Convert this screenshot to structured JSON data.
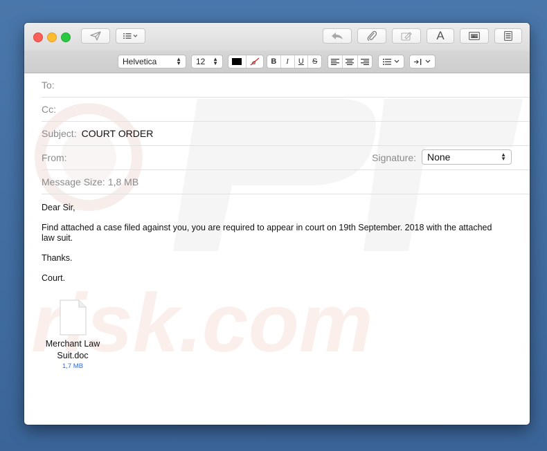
{
  "toolbar": {
    "send_icon": "paper-plane-icon",
    "header_fields_icon": "list-icon",
    "reply_icon": "reply-arrow-icon",
    "attach_icon": "paperclip-icon",
    "markup_icon": "signature-icon",
    "format_label": "A",
    "photo_icon": "photo-browser-icon",
    "stationery_icon": "stationery-icon"
  },
  "format_bar": {
    "font": "Helvetica",
    "size": "12",
    "bold": "B",
    "italic": "I",
    "underline": "U",
    "strike": "S"
  },
  "headers": {
    "to_label": "To:",
    "cc_label": "Cc:",
    "subject_label": "Subject:",
    "subject_value": "COURT ORDER",
    "from_label": "From:",
    "signature_label": "Signature:",
    "signature_value": "None",
    "size_label": "Message Size:",
    "size_value": "1,8 MB"
  },
  "message": {
    "greeting": "Dear Sir,",
    "body": "Find attached a case filed against you, you are required to appear in court on 19th September. 2018 with the attached law suit.",
    "thanks": "Thanks.",
    "sign": "Court."
  },
  "attachment": {
    "name_line1": "Merchant Law",
    "name_line2": "Suit.doc",
    "size": "1,7 MB"
  },
  "colors": {
    "close": "#fc5f57",
    "minimize": "#fdbc2e",
    "maximize": "#28c840",
    "link": "#2d6bd1"
  }
}
